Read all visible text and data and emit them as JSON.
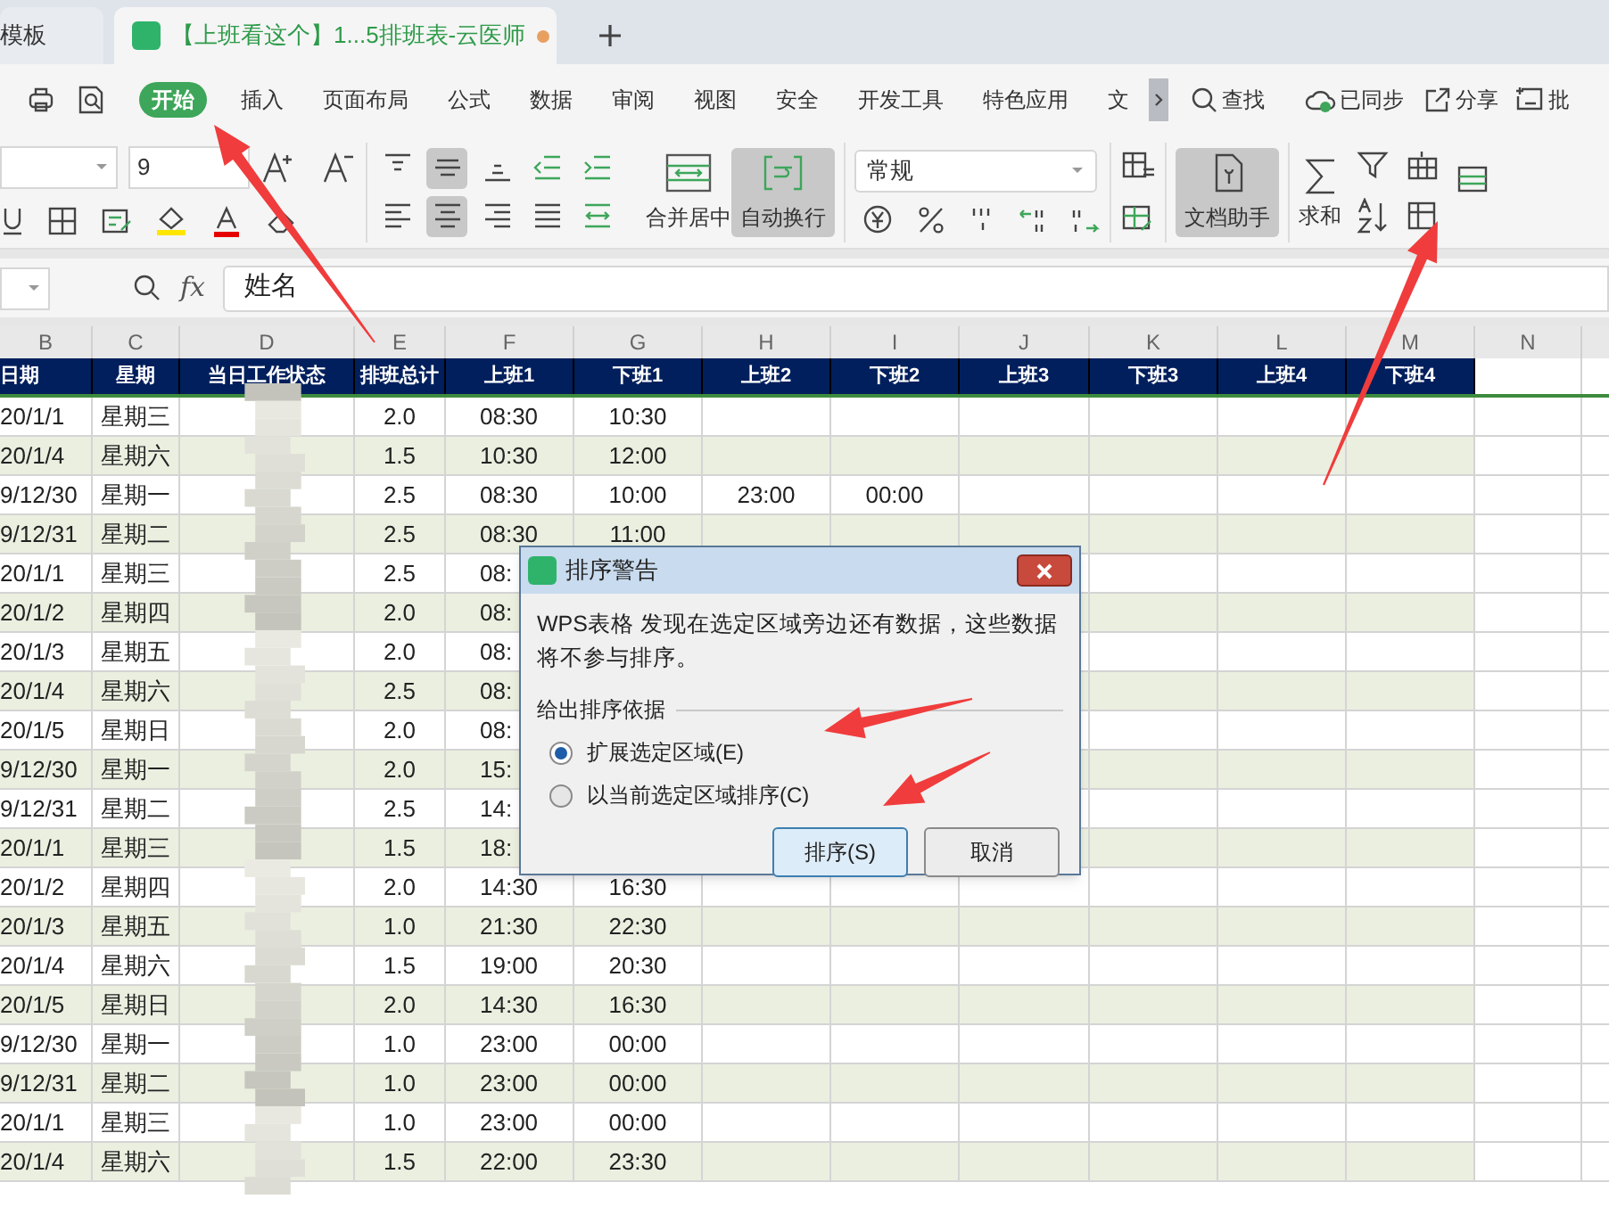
{
  "tabs": [
    {
      "title": "模板",
      "selected": false,
      "unsaved": false
    },
    {
      "title": "【上班看这个】1...5排班表-云医师",
      "selected": true,
      "unsaved": true
    }
  ],
  "menu": [
    {
      "label": "开始",
      "selected": true
    },
    {
      "label": "插入",
      "selected": false
    },
    {
      "label": "页面布局",
      "selected": false
    },
    {
      "label": "公式",
      "selected": false
    },
    {
      "label": "数据",
      "selected": false
    },
    {
      "label": "审阅",
      "selected": false
    },
    {
      "label": "视图",
      "selected": false
    },
    {
      "label": "安全",
      "selected": false
    },
    {
      "label": "开发工具",
      "selected": false
    },
    {
      "label": "特色应用",
      "selected": false
    },
    {
      "label": "文",
      "selected": false
    }
  ],
  "menu_right": {
    "search": "查找",
    "sync": "已同步",
    "share": "分享",
    "cut": "批"
  },
  "toolbar": {
    "font_size": "9",
    "merge": {
      "label": "合并居中",
      "pressed": false
    },
    "wrap": {
      "label": "自动换行",
      "pressed": true
    },
    "number_format": "常规",
    "assistant": {
      "label": "文档助手",
      "pressed": true
    },
    "sum": "求和"
  },
  "formula_bar": {
    "function_label": "fx",
    "value": "姓名"
  },
  "columns": [
    "B",
    "C",
    "D",
    "E",
    "F",
    "G",
    "H",
    "I",
    "J",
    "K",
    "L",
    "M",
    "N"
  ],
  "header": [
    "日期",
    "星期",
    "当日工作状态",
    "排班总计",
    "上班1",
    "下班1",
    "上班2",
    "下班2",
    "上班3",
    "下班3",
    "上班4",
    "下班4"
  ],
  "rows": [
    {
      "date": "20/1/1",
      "weekday": "星期三",
      "total": "2.0",
      "on1": "08:30",
      "off1": "10:30"
    },
    {
      "date": "20/1/4",
      "weekday": "星期六",
      "total": "1.5",
      "on1": "10:30",
      "off1": "12:00"
    },
    {
      "date": "9/12/30",
      "weekday": "星期一",
      "total": "2.5",
      "on1": "08:30",
      "off1": "10:00",
      "on2": "23:00",
      "off2": "00:00"
    },
    {
      "date": "9/12/31",
      "weekday": "星期二",
      "total": "2.5",
      "on1": "08:30",
      "off1": "11:00"
    },
    {
      "date": "20/1/1",
      "weekday": "星期三",
      "total": "2.5",
      "on1": "08:"
    },
    {
      "date": "20/1/2",
      "weekday": "星期四",
      "total": "2.0",
      "on1": "08:"
    },
    {
      "date": "20/1/3",
      "weekday": "星期五",
      "total": "2.0",
      "on1": "08:"
    },
    {
      "date": "20/1/4",
      "weekday": "星期六",
      "total": "2.5",
      "on1": "08:"
    },
    {
      "date": "20/1/5",
      "weekday": "星期日",
      "total": "2.0",
      "on1": "08:"
    },
    {
      "date": "9/12/30",
      "weekday": "星期一",
      "total": "2.0",
      "on1": "15:"
    },
    {
      "date": "9/12/31",
      "weekday": "星期二",
      "total": "2.5",
      "on1": "14:"
    },
    {
      "date": "20/1/1",
      "weekday": "星期三",
      "total": "1.5",
      "on1": "18:"
    },
    {
      "date": "20/1/2",
      "weekday": "星期四",
      "total": "2.0",
      "on1": "14:30",
      "off1": "16:30"
    },
    {
      "date": "20/1/3",
      "weekday": "星期五",
      "total": "1.0",
      "on1": "21:30",
      "off1": "22:30"
    },
    {
      "date": "20/1/4",
      "weekday": "星期六",
      "total": "1.5",
      "on1": "19:00",
      "off1": "20:30"
    },
    {
      "date": "20/1/5",
      "weekday": "星期日",
      "total": "2.0",
      "on1": "14:30",
      "off1": "16:30"
    },
    {
      "date": "9/12/30",
      "weekday": "星期一",
      "total": "1.0",
      "on1": "23:00",
      "off1": "00:00"
    },
    {
      "date": "9/12/31",
      "weekday": "星期二",
      "total": "1.0",
      "on1": "23:00",
      "off1": "00:00"
    },
    {
      "date": "20/1/1",
      "weekday": "星期三",
      "total": "1.0",
      "on1": "23:00",
      "off1": "00:00"
    },
    {
      "date": "20/1/4",
      "weekday": "星期六",
      "total": "1.5",
      "on1": "22:00",
      "off1": "23:30"
    }
  ],
  "dialog": {
    "title": "排序警告",
    "message": "WPS表格 发现在选定区域旁边还有数据，这些数据将不参与排序。",
    "group": "给出排序依据",
    "options": [
      {
        "label": "扩展选定区域(E)",
        "selected": true
      },
      {
        "label": "以当前选定区域排序(C)",
        "selected": false
      }
    ],
    "buttons": [
      {
        "label": "排序(S)",
        "kind": "default"
      },
      {
        "label": "取消",
        "kind": "normal"
      }
    ]
  }
}
